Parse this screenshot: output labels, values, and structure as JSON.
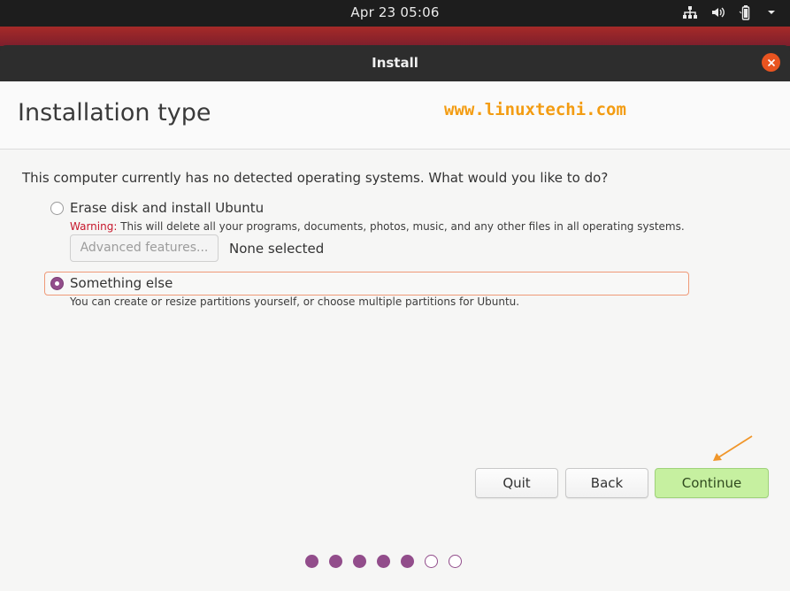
{
  "topbar": {
    "clock": "Apr 23  05:06"
  },
  "window": {
    "title": "Install"
  },
  "header": {
    "title": "Installation type",
    "watermark": "www.linuxtechi.com"
  },
  "main": {
    "question": "This computer currently has no detected operating systems. What would you like to do?",
    "options": [
      {
        "label": "Erase disk and install Ubuntu",
        "selected": false,
        "warning_prefix": "Warning:",
        "warning_text": " This will delete all your programs, documents, photos, music, and any other files in all operating systems."
      },
      {
        "label": "Something else",
        "selected": true,
        "description": "You can create or resize partitions yourself, or choose multiple partitions for Ubuntu."
      }
    ],
    "advanced_button": "Advanced features...",
    "advanced_status": "None selected"
  },
  "buttons": {
    "quit": "Quit",
    "back": "Back",
    "continue": "Continue"
  },
  "progress": {
    "total_steps": 7,
    "completed_steps": 5
  },
  "colors": {
    "accent": "#924d8b",
    "close": "#e95420",
    "continue_bg": "#c6f0a0",
    "warning": "#c7162b",
    "watermark": "#f39c12"
  }
}
